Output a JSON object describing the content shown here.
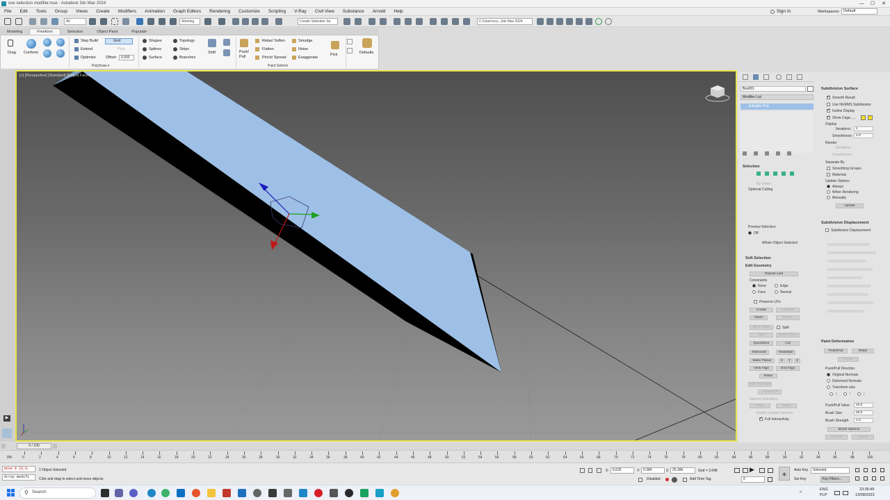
{
  "window": {
    "title": "uve selection modifier.max - Autodesk 3ds Max 2024",
    "controls": [
      "—",
      "☐",
      "✕"
    ]
  },
  "menu": {
    "items": [
      "File",
      "Edit",
      "Tools",
      "Group",
      "Views",
      "Create",
      "Modifiers",
      "Animation",
      "Graph Editors",
      "Rendering",
      "Customize",
      "Scripting",
      "V-Ray",
      "Civil View",
      "Substance",
      "Arnold",
      "Help"
    ],
    "sign_in": "Sign In",
    "workspaces_label": "Workspaces:",
    "workspaces_value": "Default"
  },
  "toolbar": {
    "filter_value": "All",
    "coord_value": "Working",
    "selection_set": "Create Selection Se",
    "path": "C:\\Users\\cry...3ds Max 2024"
  },
  "ribbon": {
    "tabs": [
      "Modeling",
      "Freeform",
      "Selection",
      "Object Paint",
      "Populate"
    ],
    "active_tab": "Freeform",
    "drag": "Drag",
    "conform": "Conform",
    "step_build": "Step Build",
    "extend": "Extend",
    "optimize": "Optimize",
    "grid": "Grid",
    "pick": "Pick",
    "offset_label": "Offset:",
    "offset_value": "0.000",
    "shapes": "Shapes",
    "splines": "Splines",
    "surface": "Surface",
    "topology": "Topology",
    "strips": "Strips",
    "branches": "Branches",
    "shift": "Shift",
    "push_pull": "Push/\nPull",
    "relax_soften": "Relax/ Soften",
    "flatten": "Flatten",
    "pinch_spread": "Pinch/ Spread",
    "smudge": "Smudge",
    "noise": "Noise",
    "exaggerate": "Exaggerate",
    "pick2": "Pick",
    "defaults": "Defaults",
    "group_polydraw": "PolyDraw ▾",
    "group_paint": "Paint Deform"
  },
  "viewport": {
    "label": "[+] [Perspective] [Standard] [Edged Faces]"
  },
  "command_panel": {
    "object_name": "Box001",
    "modifier_list": "Modifier List",
    "stack_item": "Editable Poly",
    "selection_head": "Selection",
    "by_vertex": "By Vertex",
    "optional_culling": "Optional Culling",
    "preview_selection": "Preview Selection",
    "off": "Off",
    "whole_object": "Whole Object Selected",
    "soft_selection": "Soft Selection",
    "edit_geometry": "Edit Geometry",
    "repeat_last": "Repeat Last",
    "constraints": "Constraints",
    "none": "None",
    "edge": "Edge",
    "face": "Face",
    "normal": "Normal",
    "preserve_uvs": "Preserve UVs",
    "create": "Create",
    "collapse": "Collapse",
    "attach": "Attach",
    "detach": "Detach",
    "slice_plane": "Slice Plane",
    "split": "Split",
    "slice": "Slice",
    "reset_plane": "Reset Plane",
    "quickslice": "QuickSlice",
    "cut": "Cut",
    "msmooth": "MSmooth",
    "tessellate": "Tessellate",
    "make_planar": "Make Planar",
    "x": "X",
    "y": "Y",
    "z": "Z",
    "view_align": "View Align",
    "grid_align": "Grid Align",
    "relax": "Relax",
    "hide_selected": "Hide Selected",
    "unhide_all": "Unhide All",
    "hide_unselected": "Hide Unselected",
    "named_selections": "Named Selections:",
    "copy": "Copy",
    "paste": "Paste",
    "delete_isolated": "Delete Isolated Vertices",
    "full_interactivity": "Full Interactivity",
    "subdiv_surface": "Subdivision Surface",
    "smooth_result": "Smooth Result",
    "use_nurms": "Use NURMS Subdivision",
    "isoline_display": "Isoline Display",
    "show_cage": "Show Cage......",
    "display": "Display",
    "iterations": "Iterations:",
    "iterations_value": "1",
    "smoothness": "Smoothness:",
    "smoothness_value": "1.0",
    "render": "Render",
    "separate_by": "Separate By",
    "smoothing_groups": "Smoothing Groups",
    "materials": "Materials",
    "update_options": "Update Options",
    "always": "Always",
    "when_rendering": "When Rendering",
    "manually": "Manually",
    "update": "Update",
    "subdiv_displacement": "Subdivision Displacement",
    "subdiv_displacement_chk": "Subdivision Displacement",
    "paint_deformation": "Paint Deformation",
    "push_pull_btn": "Push/Pull",
    "relax_btn": "Relax",
    "revert_btn": "Revert",
    "push_pull_direction": "Push/Pull Direction",
    "original_normals": "Original Normals",
    "deformed_normals": "Deformed Normals",
    "transform_axis": "Transform axis",
    "push_pull_value": "Push/Pull Value",
    "push_pull_value_num": "10.0",
    "brush_size": "Brush Size",
    "brush_size_num": "20.0",
    "brush_strength": "Brush Strength",
    "brush_strength_num": "1.0",
    "brush_options": "Brush Options",
    "commit": "Commit",
    "cancel": "Cancel"
  },
  "timeline": {
    "frame": "0 / 100",
    "ticks": [
      "0",
      "2",
      "4",
      "6",
      "8",
      "10",
      "12",
      "14",
      "16",
      "18",
      "20",
      "22",
      "24",
      "26",
      "28",
      "30",
      "32",
      "34",
      "36",
      "38",
      "40",
      "42",
      "44",
      "46",
      "48",
      "50",
      "52",
      "54",
      "56",
      "58",
      "60",
      "62",
      "64",
      "66",
      "68",
      "70",
      "72",
      "74",
      "76",
      "78",
      "80",
      "82",
      "84",
      "86",
      "88",
      "90",
      "92",
      "94",
      "96",
      "98",
      "100"
    ]
  },
  "status": {
    "script1": "move $ [0,0,",
    "script2": "Array modifi",
    "objects": "1 Object Selected",
    "prompt": "Click and drag to select and move objects",
    "x_label": "X:",
    "x_value": "6.632",
    "y_label": "Y:",
    "y_value": "0.384",
    "z_label": "Z:",
    "z_value": "25.396",
    "grid": "Grid = 3.048",
    "disabled": "Disabled:",
    "add_time_tag": "Add Time Tag",
    "auto_key": "Auto Key",
    "selected": "Selected",
    "set_key": "Set Key",
    "key_filters": "Key Filters...",
    "frame_value": "0"
  },
  "taskbar": {
    "search": "Search",
    "lang1": "ENG",
    "lang2": "PLP",
    "time": "23:36:45",
    "date": "13/08/2023"
  }
}
